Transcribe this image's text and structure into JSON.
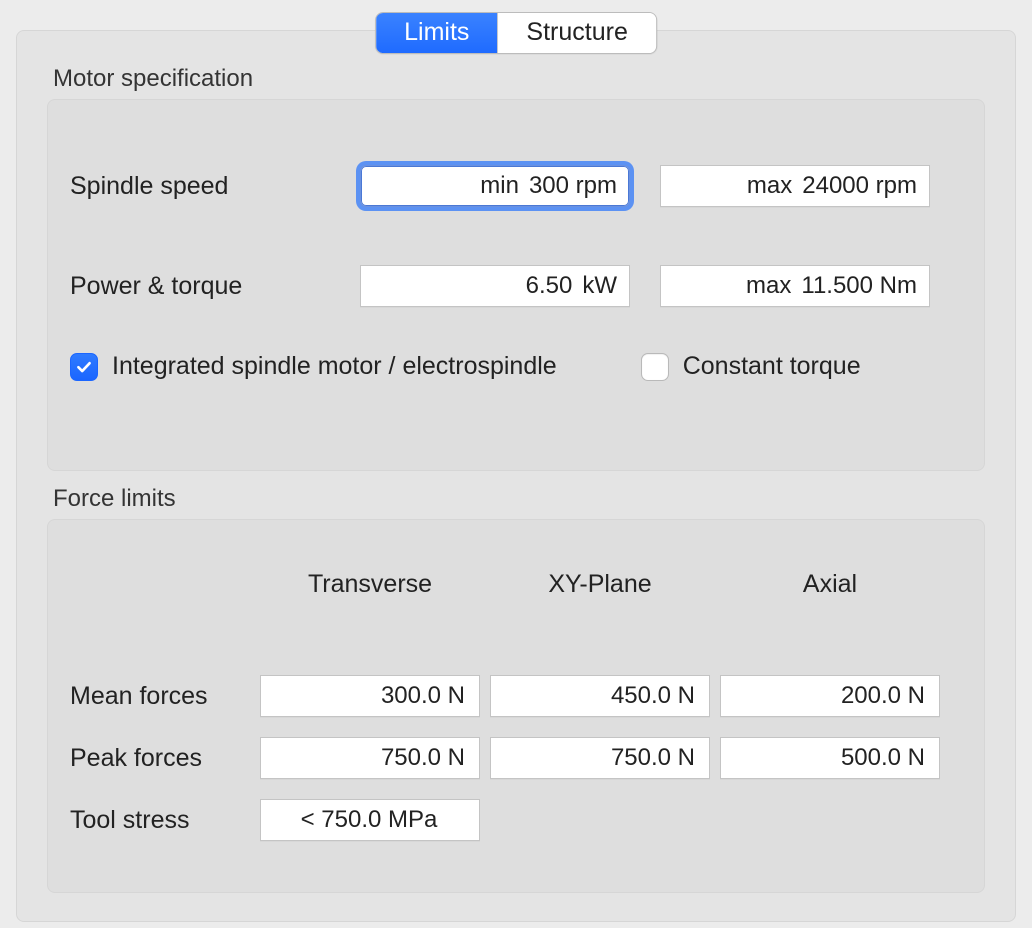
{
  "tabs": {
    "limits": "Limits",
    "structure": "Structure"
  },
  "motor": {
    "section_label": "Motor specification",
    "spindle_label": "Spindle speed",
    "spindle_min_prefix": "min",
    "spindle_min_value": "300 rpm",
    "spindle_max_prefix": "max",
    "spindle_max_value": "24000 rpm",
    "power_label": "Power & torque",
    "power_value": "6.50",
    "power_unit": "kW",
    "torque_prefix": "max",
    "torque_value": "11.500 Nm",
    "integrated_label": "Integrated spindle motor / electrospindle",
    "constant_torque_label": "Constant torque"
  },
  "force": {
    "section_label": "Force limits",
    "col_transverse": "Transverse",
    "col_xyplane": "XY-Plane",
    "col_axial": "Axial",
    "mean_label": "Mean forces",
    "mean_transverse": "300.0 N",
    "mean_xyplane": "450.0 N",
    "mean_axial": "200.0 N",
    "peak_label": "Peak forces",
    "peak_transverse": "750.0 N",
    "peak_xyplane": "750.0 N",
    "peak_axial": "500.0 N",
    "tool_stress_label": "Tool stress",
    "tool_stress_value": "< 750.0 MPa"
  }
}
